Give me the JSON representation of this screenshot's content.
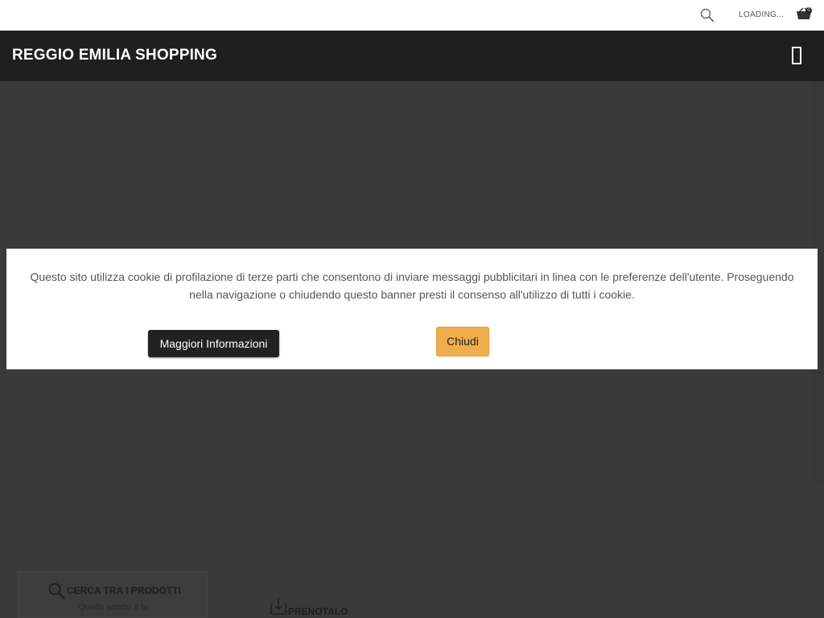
{
  "topbar": {
    "loading_text": "LOADING...",
    "cart_count": "0",
    "icons": {
      "search": "search-icon",
      "cart": "cart-icon"
    }
  },
  "header": {
    "brand": "REGGIO EMILIA SHOPPING",
    "menu_icon": "menu-icon"
  },
  "cookie_banner": {
    "message": "Questo sito utilizza cookie di profilazione di terze parti che consentono di inviare messaggi pubblicitari in linea con le preferenze dell'utente. Proseguendo nella navigazione o chiudendo questo banner presti il consenso all'utilizzo di tutti i cookie.",
    "more_info_label": "Maggiori Informazioni",
    "close_label": "Chiudi"
  },
  "features": {
    "search_products": {
      "title": "CERCA TRA I PRODOTTI",
      "subtitle": "Quello adatto a te"
    },
    "book_it": {
      "title": "PRENOTALO"
    }
  },
  "colors": {
    "header_bg": "#1f1f1f",
    "page_bg": "#3a3a3a",
    "accent": "#f0ad4e"
  }
}
